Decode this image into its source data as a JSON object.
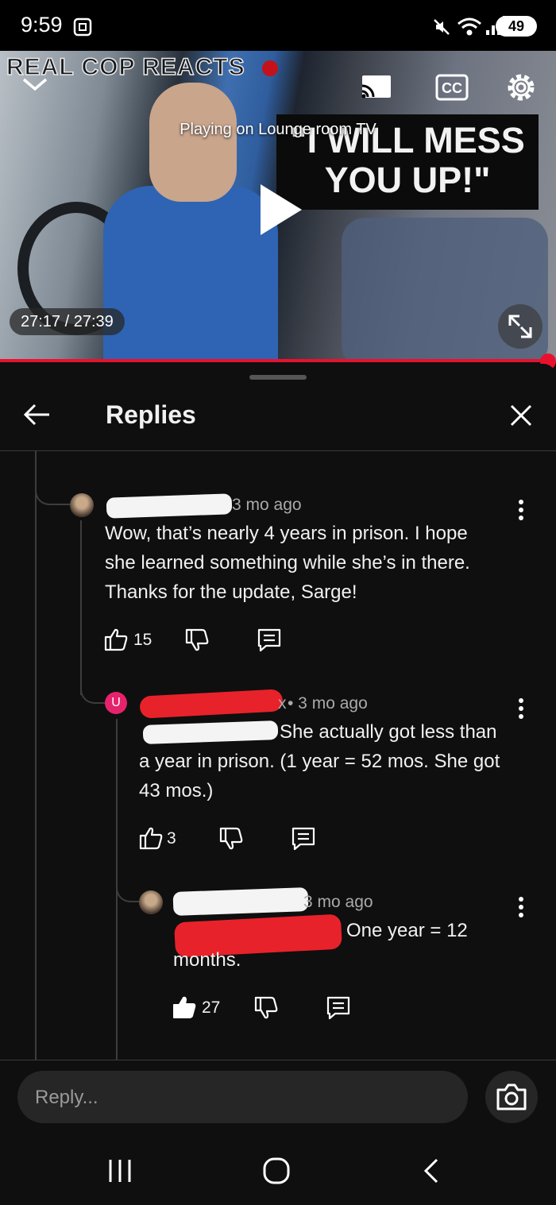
{
  "status_bar": {
    "time": "9:59",
    "battery": "49"
  },
  "video": {
    "channel_overlay": "REAL COP REACTS",
    "casting_text": "Playing on Lounge room TV",
    "caption_text": "\"I WILL MESS YOU UP!\"",
    "time_display": "27:17 / 27:39",
    "progress_fraction": 0.985,
    "accent_color": "#e8112d"
  },
  "panel": {
    "title": "Replies"
  },
  "comments": [
    {
      "time_ago": "3 mo ago",
      "text": "Wow, that’s nearly 4 years in prison. I hope she learned something while she’s in there. Thanks for the update, Sarge!",
      "likes": "15"
    },
    {
      "avatar_letter": "U",
      "handle_suffix": "x",
      "time_ago": "• 3 mo ago",
      "text_line1": "She actually got less than",
      "text_rest": "a year in prison. (1 year = 52 mos. She got 43 mos.)",
      "likes": "3"
    },
    {
      "time_ago": "3 mo ago",
      "text_line1": "One year = 12",
      "text_rest": "months.",
      "likes": "27"
    }
  ],
  "reply_bar": {
    "placeholder": "Reply..."
  },
  "icons": [
    "wifi-icon",
    "signal-icon",
    "mute-icon",
    "cast-icon",
    "cc-icon",
    "settings-icon",
    "play-icon",
    "fullscreen-icon",
    "back-arrow-icon",
    "close-icon",
    "thumbs-up-icon",
    "thumbs-down-icon",
    "reply-icon",
    "more-icon",
    "camera-icon",
    "recents-icon",
    "home-icon",
    "back-icon"
  ]
}
